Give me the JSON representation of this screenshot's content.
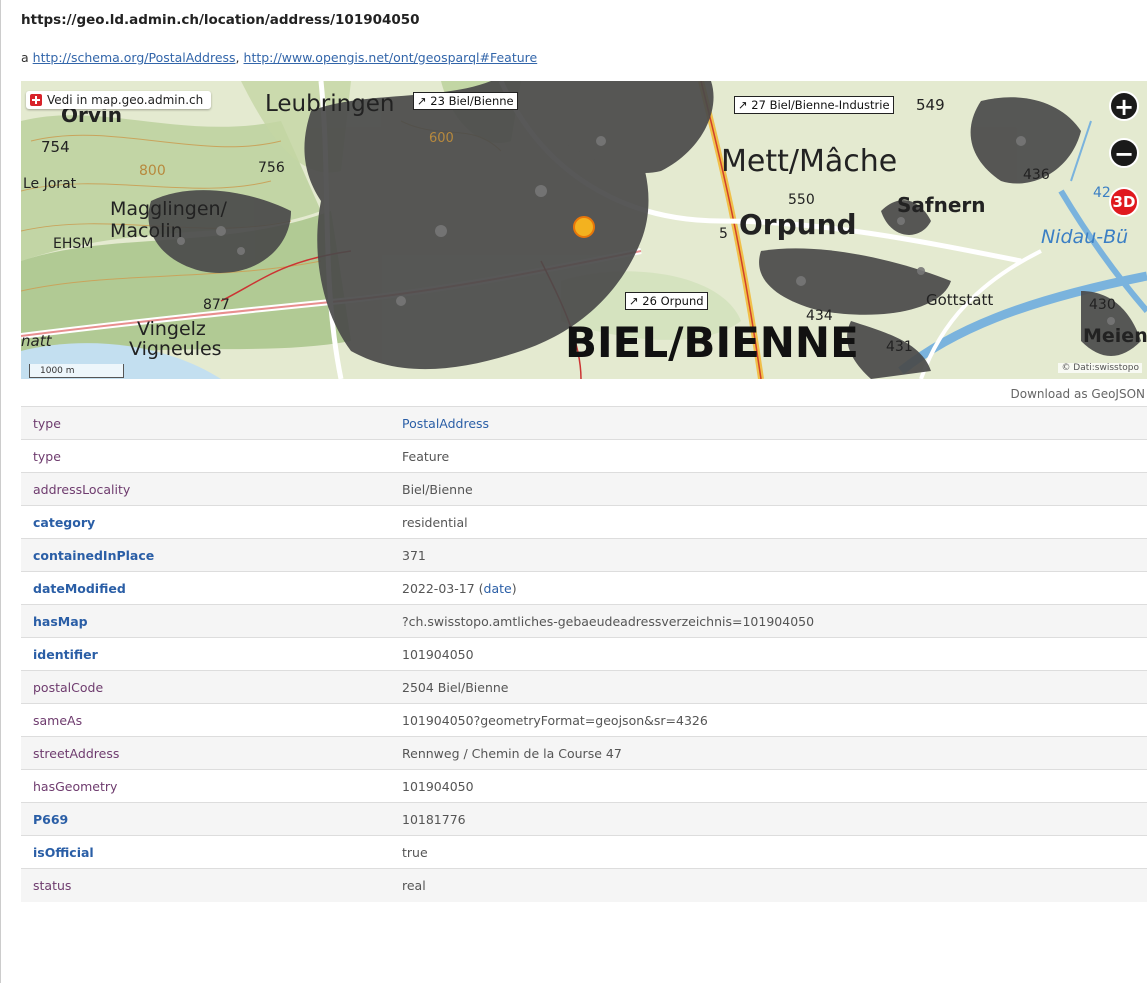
{
  "header": {
    "url": "https://geo.ld.admin.ch/location/address/101904050",
    "type_prefix": "a",
    "type_link_1": "http://schema.org/PostalAddress",
    "type_separator": ",",
    "type_link_2": "http://www.opengis.net/ont/geosparql#Feature"
  },
  "map": {
    "view_badge": "Vedi in map.geo.admin.ch",
    "zoom_in": "+",
    "zoom_out": "−",
    "btn_3d": "3D",
    "scale": "1000 m",
    "attribution": "© Dati:swisstopo",
    "labels": {
      "leubringen": "Leubringen",
      "orvin": "Orvin",
      "le_jorat": "Le Jorat",
      "magglingen": "Magglingen/",
      "macolin": "Macolin",
      "ehsm": "EHSM",
      "vingelz": "Vingelz",
      "vigneules": "Vigneules",
      "natt": "natt",
      "mett": "Mett/Mâche",
      "orpund": "Orpund",
      "biel": "BIEL/BIENNE",
      "safnern": "Safnern",
      "gottstatt": "Gottstatt",
      "meienried": "Meienrie",
      "nidau_buren": "Nidau-Bü",
      "h754": "754",
      "h756": "756",
      "h800": "800",
      "h600": "600",
      "h877": "877",
      "h550": "550",
      "h436": "436",
      "h434": "434",
      "h431": "431",
      "h430": "430",
      "h549": "549",
      "h5": "5",
      "h42": "42"
    },
    "road_23": "↗ 23 Biel/Bienne",
    "road_27": "↗ 27 Biel/Bienne-Industrie",
    "road_26": "↗ 26 Orpund"
  },
  "download_label": "Download as GeoJSON",
  "rows": [
    {
      "key": "type",
      "value": "PostalAddress"
    },
    {
      "key": "type",
      "value": "Feature"
    },
    {
      "key": "addressLocality",
      "value": "Biel/Bienne"
    },
    {
      "key": "category",
      "value": "residential"
    },
    {
      "key": "containedInPlace",
      "value": "371"
    },
    {
      "key": "dateModified",
      "value": "2022-03-17",
      "extra_open": " (",
      "extra_link": "date",
      "extra_close": ")"
    },
    {
      "key": "hasMap",
      "value": "?ch.swisstopo.amtliches-gebaeudeadressverzeichnis=101904050"
    },
    {
      "key": "identifier",
      "value": "101904050"
    },
    {
      "key": "postalCode",
      "value": "2504 Biel/Bienne"
    },
    {
      "key": "sameAs",
      "value": "101904050?geometryFormat=geojson&sr=4326"
    },
    {
      "key": "streetAddress",
      "value": "Rennweg / Chemin de la Course 47"
    },
    {
      "key": "hasGeometry",
      "value": "101904050"
    },
    {
      "key": "P669",
      "value": "10181776"
    },
    {
      "key": "isOfficial",
      "value": "true"
    },
    {
      "key": "status",
      "value": "real"
    }
  ]
}
